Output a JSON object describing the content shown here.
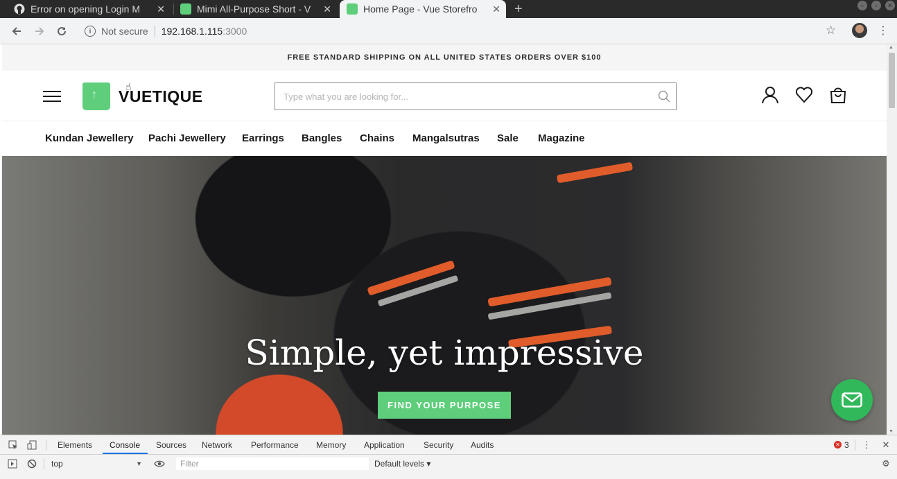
{
  "browser": {
    "tabs": [
      {
        "title": "Error on opening Login M",
        "favicon": "github-icon",
        "active": false
      },
      {
        "title": "Mimi All-Purpose Short - V",
        "favicon": "vuestorefront-bag-icon",
        "active": false
      },
      {
        "title": "Home Page - Vue Storefro",
        "favicon": "vuestorefront-bag-icon",
        "active": true
      }
    ],
    "new_tab_symbol": "+",
    "security_label": "Not secure",
    "url_host": "192.168.1.115",
    "url_port": ":3000"
  },
  "site": {
    "promo_bar": "FREE STANDARD SHIPPING ON ALL UNITED STATES ORDERS OVER $100",
    "logo_text": "VUETIQUE",
    "search_placeholder": "Type what you are looking for...",
    "categories": [
      "Kundan Jewellery",
      "Pachi Jewellery",
      "Earrings",
      "Bangles",
      "Chains",
      "Mangalsutras",
      "Sale",
      "Magazine"
    ],
    "hero": {
      "title": "Simple, yet impressive",
      "button": "FIND YOUR PURPOSE"
    },
    "accent_color": "#5ece7b"
  },
  "devtools": {
    "tabs": [
      "Elements",
      "Console",
      "Sources",
      "Network",
      "Performance",
      "Memory",
      "Application",
      "Security",
      "Audits"
    ],
    "active_tab": "Console",
    "error_count": "3",
    "context": "top",
    "filter_placeholder": "Filter",
    "levels": "Default levels ▾"
  }
}
